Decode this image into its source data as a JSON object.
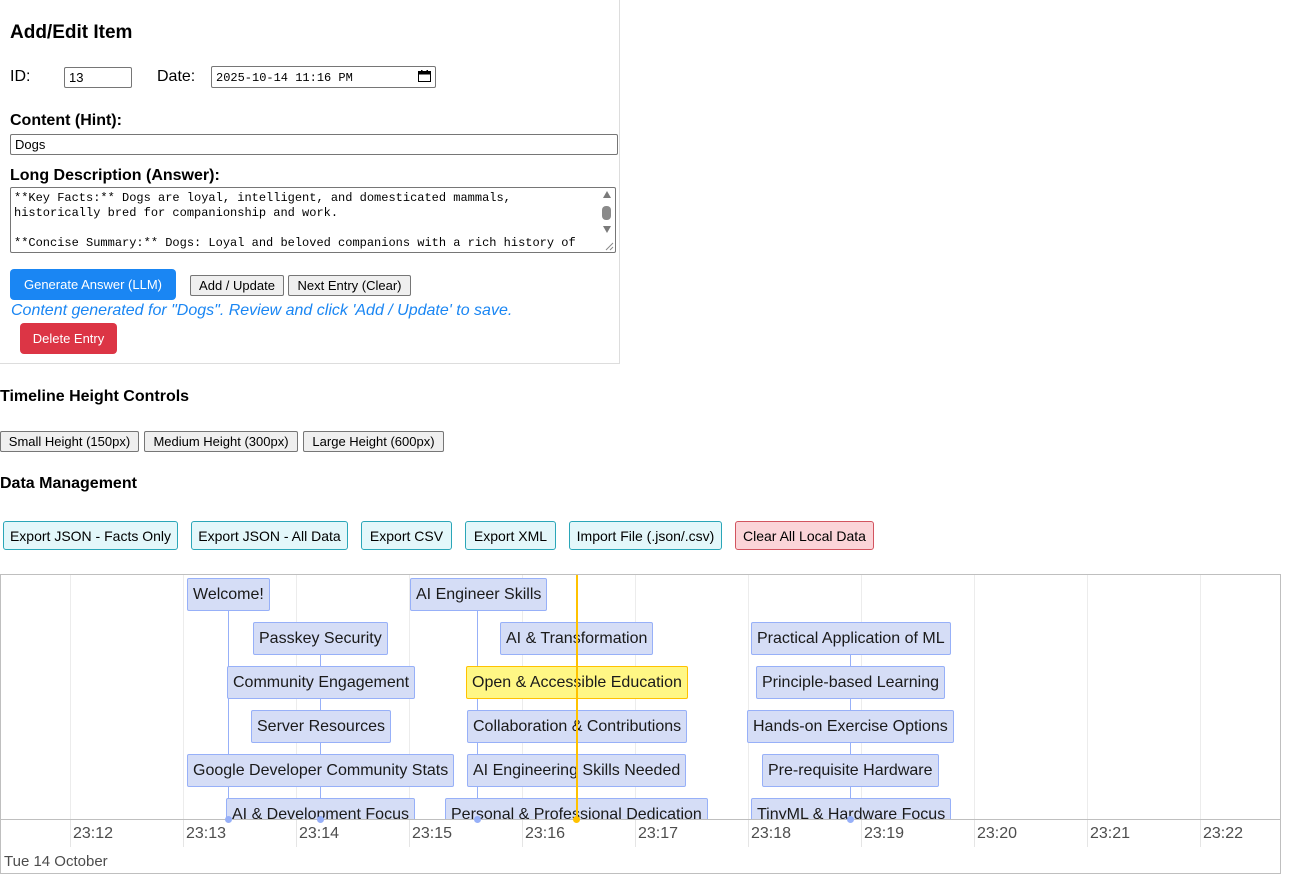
{
  "editor": {
    "title": "Add/Edit Item",
    "id_label": "ID:",
    "id_value": "13",
    "date_label": "Date:",
    "date_value": "2025-10-14 11:16 PM",
    "content_label": "Content (Hint):",
    "content_value": "Dogs",
    "desc_label": "Long Description (Answer):",
    "desc_value": "**Key Facts:** Dogs are loyal, intelligent, and domesticated mammals,\nhistorically bred for companionship and work.\n\n**Concise Summary:** Dogs: Loyal and beloved companions with a rich history of",
    "generate_label": "Generate Answer (LLM)",
    "add_label": "Add / Update",
    "next_label": "Next Entry (Clear)",
    "status": "Content generated for \"Dogs\". Review and click 'Add / Update' to save.",
    "delete_label": "Delete Entry"
  },
  "height_controls": {
    "title": "Timeline Height Controls",
    "small": "Small Height (150px)",
    "medium": "Medium Height (300px)",
    "large": "Large Height (600px)"
  },
  "data_management": {
    "title": "Data Management",
    "export_facts": "Export JSON - Facts Only",
    "export_all": "Export JSON - All Data",
    "export_csv": "Export CSV",
    "export_xml": "Export XML",
    "import": "Import File (.json/.csv)",
    "clear": "Clear All Local Data"
  },
  "timeline": {
    "items": [
      "Welcome!",
      "Passkey Security",
      "Community Engagement",
      "Server Resources",
      "Google Developer Community Stats",
      "AI & Development Focus",
      "AI Engineer Skills",
      "AI & Transformation",
      "Open & Accessible Education",
      "Collaboration & Contributions",
      "AI Engineering Skills Needed",
      "Personal & Professional Dedication",
      "Practical Application of ML",
      "Principle-based Learning",
      "Hands-on Exercise Options",
      "Pre-requisite Hardware",
      "TinyML & Hardware Focus"
    ],
    "selected_item": "Open & Accessible Education",
    "ticks": [
      "23:12",
      "23:13",
      "23:14",
      "23:15",
      "23:16",
      "23:17",
      "23:18",
      "23:19",
      "23:20",
      "23:21",
      "23:22"
    ],
    "major_label": "Tue 14 October",
    "colors": {
      "item_bg": "#d5ddf6",
      "item_border": "#97b0f8",
      "selected_bg": "#fff785",
      "current_time": "#ffc200"
    }
  }
}
